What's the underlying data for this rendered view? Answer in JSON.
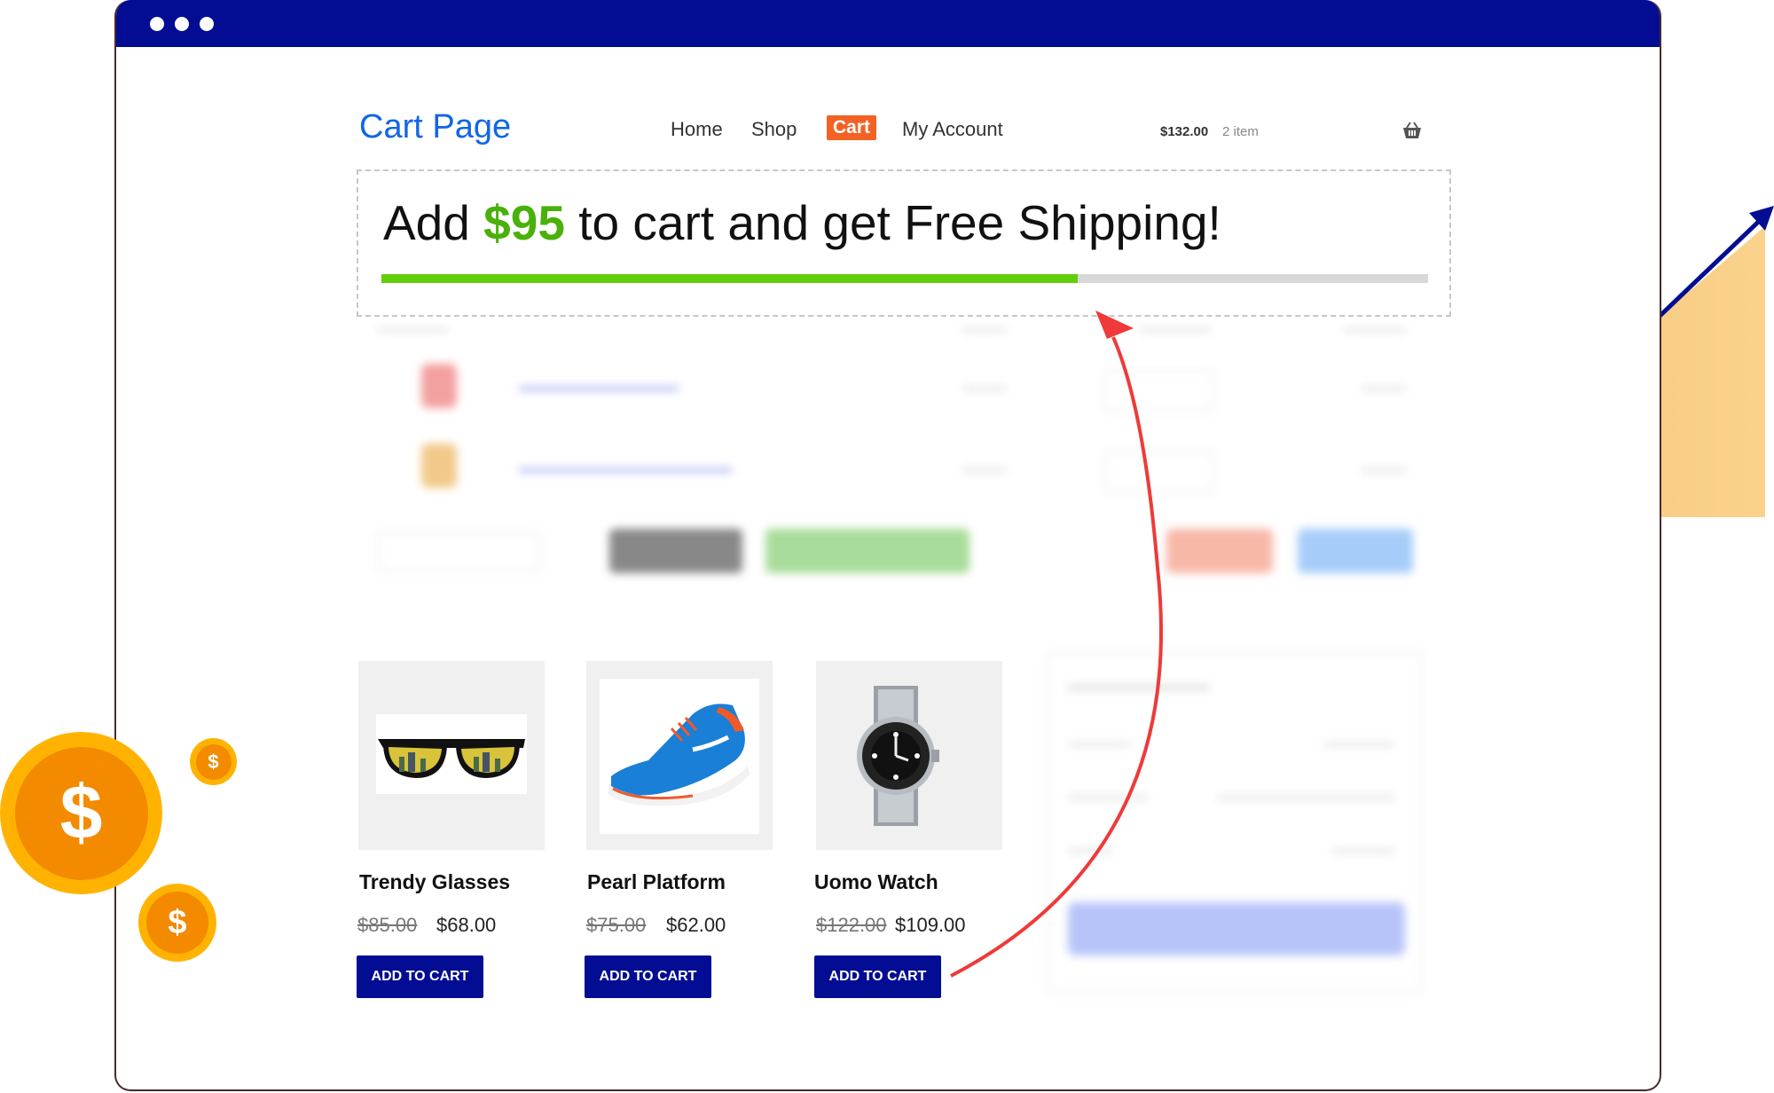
{
  "header": {
    "brand": "Cart Page",
    "nav": [
      "Home",
      "Shop",
      "Cart",
      "My Account"
    ],
    "active_nav": "Cart",
    "cart_total": "$132.00",
    "cart_count": "2 item"
  },
  "banner": {
    "prefix": "Add",
    "amount": "$95",
    "suffix": "to cart and get Free Shipping!",
    "progress": 0.665
  },
  "products": [
    {
      "name": "Trendy Glasses",
      "old_price": "$85.00",
      "price": "$68.00",
      "button": "ADD TO CART",
      "icon": "sunglasses-image"
    },
    {
      "name": "Pearl Platform",
      "old_price": "$75.00",
      "price": "$62.00",
      "button": "ADD TO CART",
      "icon": "sneaker-image"
    },
    {
      "name": "Uomo Watch",
      "old_price": "$122.00",
      "price": "$109.00",
      "button": "ADD TO CART",
      "icon": "watch-image"
    }
  ],
  "colors": {
    "titlebar": "#020d93",
    "brand": "#1166e8",
    "accent": "#f26224",
    "progress": "#63cd0b",
    "amount": "#49b10a",
    "button": "#020d93",
    "chart_fill": "#f5c87a",
    "coin": "#f38a00"
  }
}
